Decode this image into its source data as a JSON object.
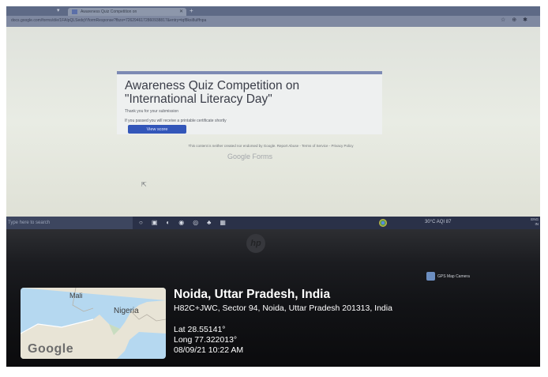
{
  "browser": {
    "tab_title": "Awareness Quiz Competition on",
    "url": "docs.google.com/forms/d/e/1FAIpQLSedqY/formResponse?fbzx=7262946172860938817&entry=tqf8ksi8ulffnpa",
    "colors": {
      "tabstrip": "#5e6a86",
      "addressbar": "#7f89a1"
    }
  },
  "form": {
    "title": "Awareness Quiz Competition on \"International Literacy Day\"",
    "thanks": "Thank you for your submission",
    "certificate_note": "If you passed you will receive a printable certificate shortly",
    "view_score": "View score",
    "disclaimer": "This content is neither created nor endorsed by Google. Report Abuse - Terms of Service - Privacy Policy",
    "brand": "Google Forms",
    "accent_color": "#3356b9"
  },
  "taskbar": {
    "search_placeholder": "Type here to search",
    "tray": "30°C AQI 87",
    "lang": "ENG",
    "region": "IN"
  },
  "overlay": {
    "app_brand": "GPS Map Camera",
    "map_labels": {
      "mali": "Mali",
      "nigeria": "Nigeria",
      "google": "Google"
    },
    "location": "Noida, Uttar Pradesh, India",
    "address": "H82C+JWC, Sector 94, Noida, Uttar Pradesh 201313, India",
    "lat": "Lat 28.55141°",
    "long": "Long 77.322013°",
    "datetime": "08/09/21 10:22 AM"
  }
}
